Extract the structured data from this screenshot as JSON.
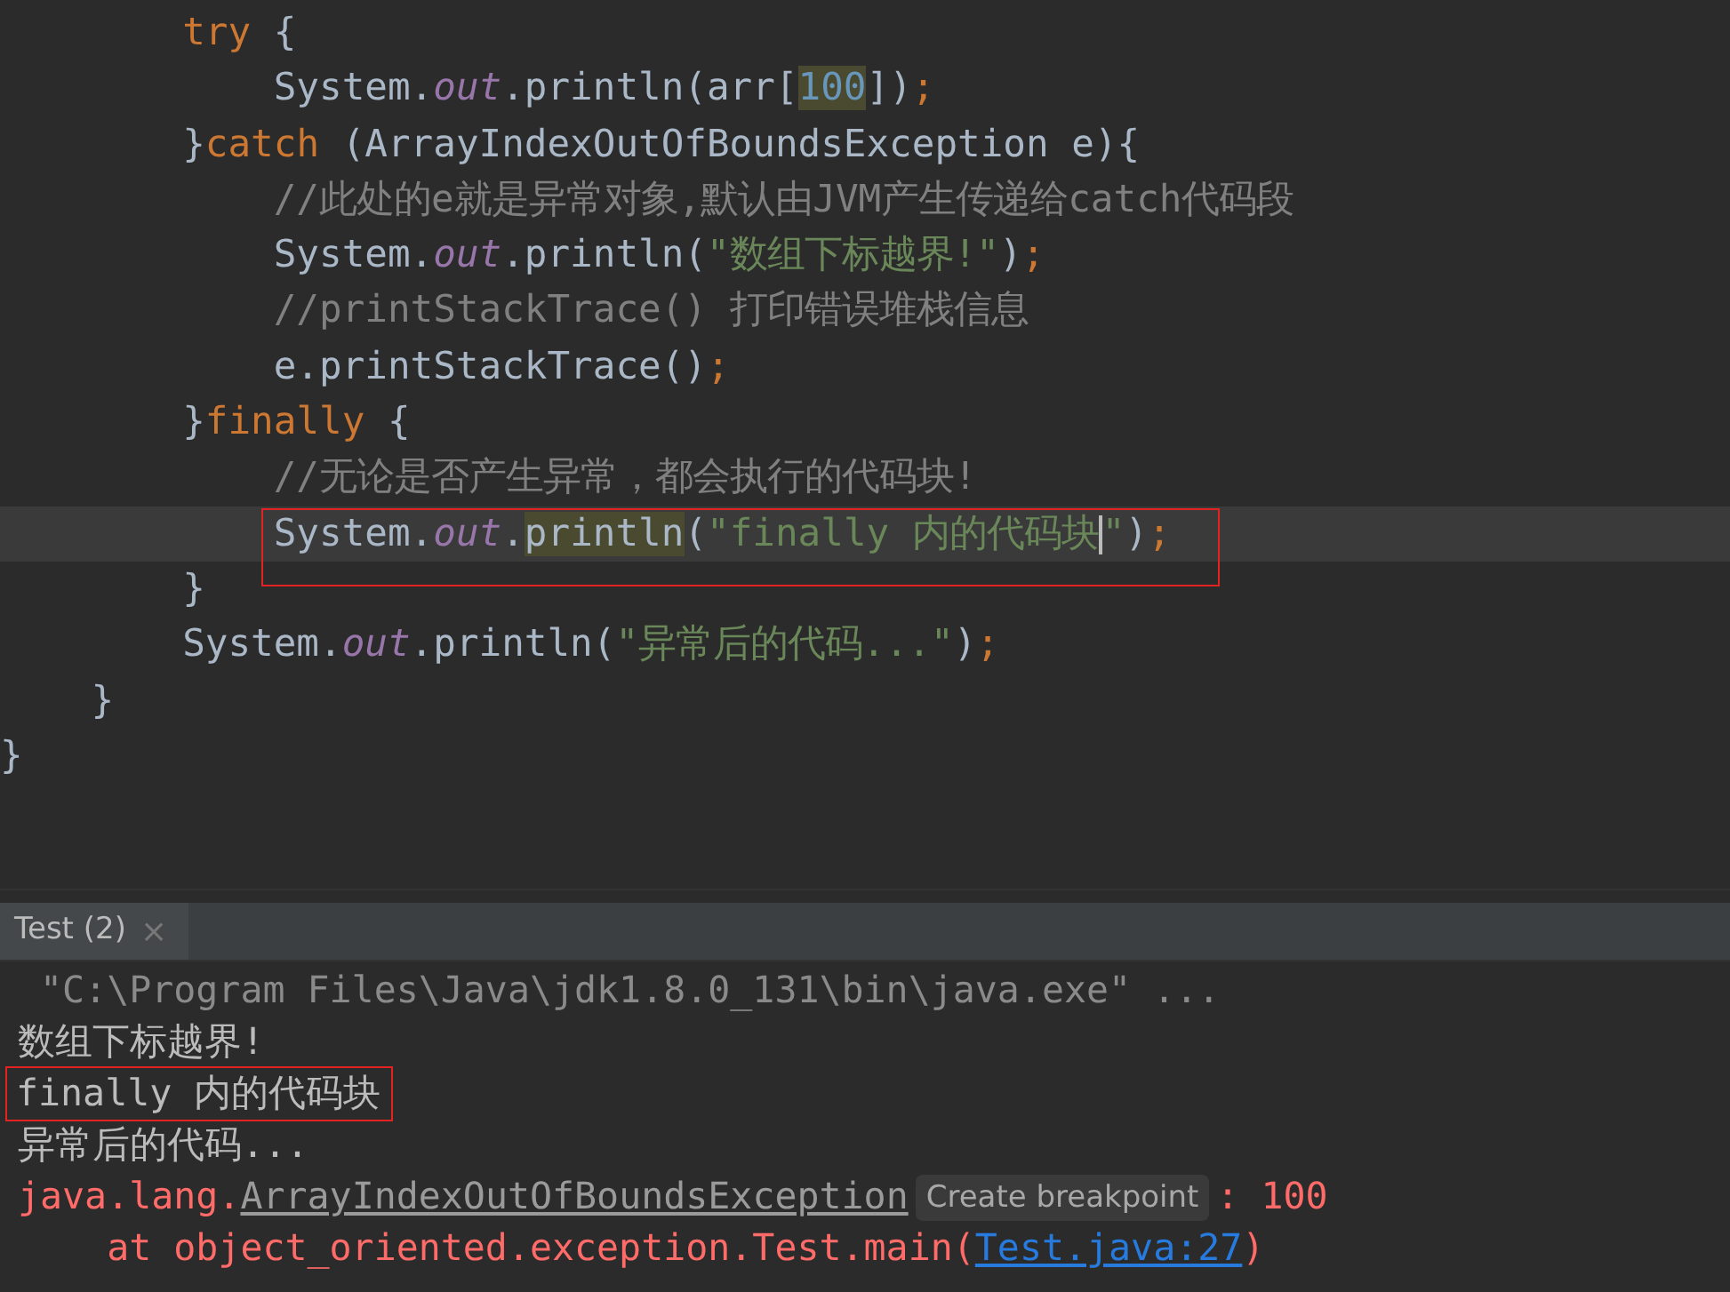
{
  "editor": {
    "lines": [
      {
        "current": false,
        "boxed": false,
        "tokens": [
          {
            "text": "        try",
            "kind": "keyword"
          },
          {
            "text": " {",
            "kind": "plain"
          }
        ]
      },
      {
        "current": false,
        "boxed": false,
        "tokens": [
          {
            "text": "            System.",
            "kind": "plain"
          },
          {
            "text": "out",
            "kind": "field"
          },
          {
            "text": ".println(arr[",
            "kind": "plain"
          },
          {
            "text": "100",
            "kind": "number",
            "highlight": true
          },
          {
            "text": "])",
            "kind": "plain"
          },
          {
            "text": ";",
            "kind": "keyword"
          }
        ]
      },
      {
        "current": false,
        "boxed": false,
        "tokens": [
          {
            "text": "        }",
            "kind": "plain"
          },
          {
            "text": "catch",
            "kind": "keyword"
          },
          {
            "text": " (ArrayIndexOutOfBoundsException e){",
            "kind": "plain"
          }
        ]
      },
      {
        "current": false,
        "boxed": false,
        "tokens": [
          {
            "text": "            //此处的e就是异常对象,默认由JVM产生传递给catch代码段",
            "kind": "comment"
          }
        ]
      },
      {
        "current": false,
        "boxed": false,
        "tokens": [
          {
            "text": "            System.",
            "kind": "plain"
          },
          {
            "text": "out",
            "kind": "field"
          },
          {
            "text": ".println(",
            "kind": "plain"
          },
          {
            "text": "\"数组下标越界!\"",
            "kind": "string"
          },
          {
            "text": ")",
            "kind": "plain"
          },
          {
            "text": ";",
            "kind": "keyword"
          }
        ]
      },
      {
        "current": false,
        "boxed": false,
        "tokens": [
          {
            "text": "            //printStackTrace() 打印错误堆栈信息",
            "kind": "comment"
          }
        ]
      },
      {
        "current": false,
        "boxed": false,
        "tokens": [
          {
            "text": "            e.printStackTrace()",
            "kind": "plain"
          },
          {
            "text": ";",
            "kind": "keyword"
          }
        ]
      },
      {
        "current": false,
        "boxed": false,
        "tokens": [
          {
            "text": "        }",
            "kind": "plain"
          },
          {
            "text": "finally",
            "kind": "keyword"
          },
          {
            "text": " {",
            "kind": "plain"
          }
        ]
      },
      {
        "current": false,
        "boxed": false,
        "tokens": [
          {
            "text": "            //无论是否产生异常，都会执行的代码块!",
            "kind": "comment"
          }
        ]
      },
      {
        "current": true,
        "boxed": true,
        "tokens": [
          {
            "text": "            System.",
            "kind": "plain"
          },
          {
            "text": "out",
            "kind": "field"
          },
          {
            "text": ".",
            "kind": "plain"
          },
          {
            "text": "println",
            "kind": "plain",
            "highlight": true
          },
          {
            "text": "(",
            "kind": "plain"
          },
          {
            "text": "\"finally 内的代码块",
            "kind": "string",
            "caret": true
          },
          {
            "text": "\"",
            "kind": "string"
          },
          {
            "text": ")",
            "kind": "plain"
          },
          {
            "text": ";",
            "kind": "keyword"
          }
        ]
      },
      {
        "current": false,
        "boxed": false,
        "tokens": [
          {
            "text": "        }",
            "kind": "plain"
          }
        ]
      },
      {
        "current": false,
        "boxed": false,
        "tokens": [
          {
            "text": "        System.",
            "kind": "plain"
          },
          {
            "text": "out",
            "kind": "field"
          },
          {
            "text": ".println(",
            "kind": "plain"
          },
          {
            "text": "\"异常后的代码...\"",
            "kind": "string"
          },
          {
            "text": ")",
            "kind": "plain"
          },
          {
            "text": ";",
            "kind": "keyword"
          }
        ]
      },
      {
        "current": false,
        "boxed": false,
        "tokens": [
          {
            "text": "    }",
            "kind": "plain"
          }
        ]
      },
      {
        "current": false,
        "boxed": false,
        "tokens": [
          {
            "text": "}",
            "kind": "plain"
          }
        ]
      }
    ]
  },
  "run_panel": {
    "tabs": [
      {
        "label": "Test (2)",
        "selected": true,
        "close": "×"
      }
    ],
    "console": [
      {
        "kind": "command",
        "boxed": false,
        "segments": [
          {
            "text": " \"C:\\Program Files\\Java\\jdk1.8.0_131\\bin\\java.exe\" ...",
            "kind": "text"
          }
        ]
      },
      {
        "kind": "output",
        "boxed": false,
        "segments": [
          {
            "text": "数组下标越界!",
            "kind": "text"
          }
        ]
      },
      {
        "kind": "output",
        "boxed": true,
        "segments": [
          {
            "text": "finally 内的代码块",
            "kind": "text"
          }
        ]
      },
      {
        "kind": "output",
        "boxed": false,
        "segments": [
          {
            "text": "异常后的代码...",
            "kind": "text"
          }
        ]
      },
      {
        "kind": "error",
        "boxed": false,
        "segments": [
          {
            "text": "java.lang.",
            "kind": "text"
          },
          {
            "text": "ArrayIndexOutOfBoundsException",
            "kind": "class_link"
          },
          {
            "text": "Create breakpoint",
            "kind": "tooltip"
          },
          {
            "text": ": 100",
            "kind": "text"
          }
        ]
      },
      {
        "kind": "error",
        "boxed": false,
        "segments": [
          {
            "text": "    at object_oriented.exception.Test.main(",
            "kind": "text"
          },
          {
            "text": "Test.java:27",
            "kind": "link"
          },
          {
            "text": ")",
            "kind": "text"
          }
        ]
      }
    ]
  }
}
